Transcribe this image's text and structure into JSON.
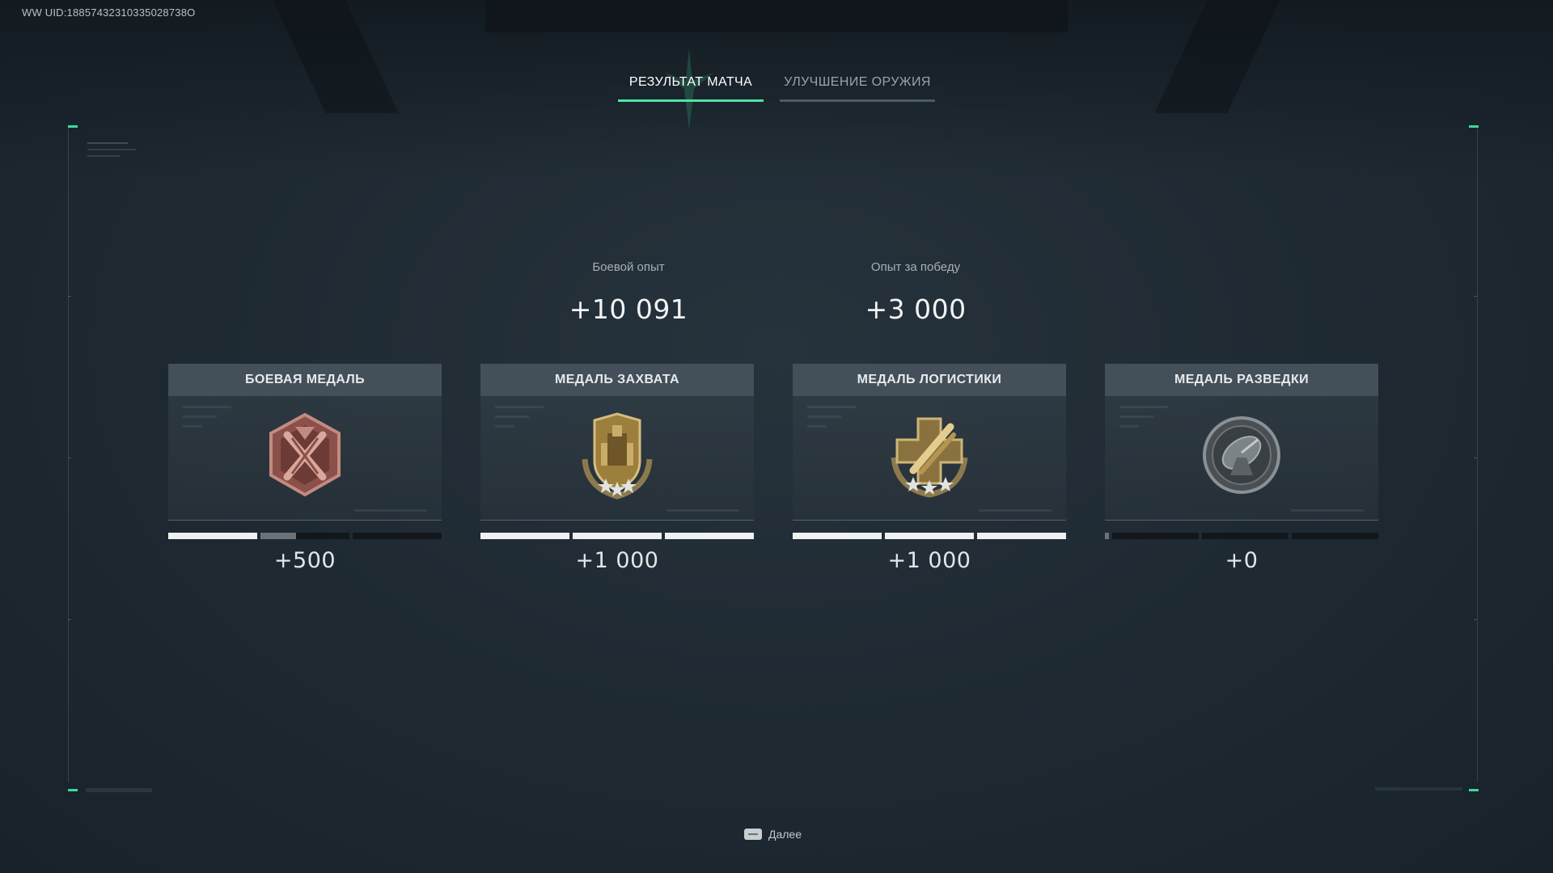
{
  "uid_text": "WW UID:18857432310335028738O",
  "tabs": [
    {
      "label": "РЕЗУЛЬТАТ МАТЧА",
      "active": true
    },
    {
      "label": "УЛУЧШЕНИЕ ОРУЖИЯ",
      "active": false
    }
  ],
  "experience": {
    "combat": {
      "label": "Боевой опыт",
      "value": "+10 091"
    },
    "victory": {
      "label": "Опыт за победу",
      "value": "+3 000"
    }
  },
  "medals": [
    {
      "title": "БОЕВАЯ МЕДАЛЬ",
      "points": "+500",
      "icon": "combat-medal-icon",
      "progress_segments_filled": 1.4,
      "segments": 3
    },
    {
      "title": "МЕДАЛЬ ЗАХВАТА",
      "points": "+1 000",
      "icon": "capture-medal-icon",
      "progress_segments_filled": 3,
      "segments": 3
    },
    {
      "title": "МЕДАЛЬ ЛОГИСТИКИ",
      "points": "+1 000",
      "icon": "logistics-medal-icon",
      "progress_segments_filled": 3,
      "segments": 3
    },
    {
      "title": "МЕДАЛЬ РАЗВЕДКИ",
      "points": "+0",
      "icon": "recon-medal-icon",
      "progress_segments_filled": 0,
      "segments": 3
    }
  ],
  "footer": {
    "next_label": "Далее",
    "next_icon": "keyboard-key-icon"
  },
  "colors": {
    "accent": "#4fe3a3",
    "background": "#1f2a33",
    "bronze": "#a0635a",
    "gold": "#b89a4e",
    "silver": "#7f8589"
  }
}
